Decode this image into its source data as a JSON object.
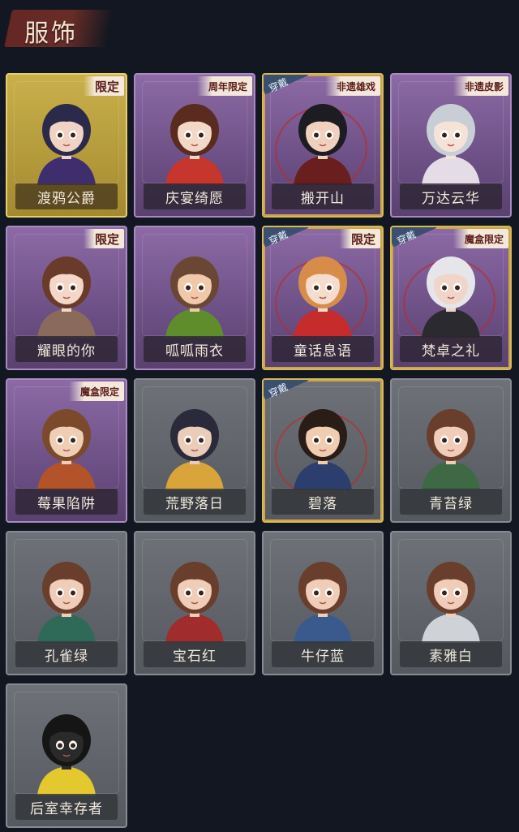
{
  "header": {
    "title": "服饰"
  },
  "cards": [
    {
      "name": "渡鸦公爵",
      "tag": "限定",
      "worn": false,
      "frame": "gold",
      "palette": {
        "hair": "#2b2a4a",
        "skin": "#f0d3c3",
        "outfit": "#3f2e6e"
      }
    },
    {
      "name": "庆宴绮愿",
      "tag": "周年限定",
      "worn": false,
      "frame": "purple",
      "palette": {
        "hair": "#5a2b1f",
        "skin": "#f3d8c6",
        "outfit": "#c7362c"
      }
    },
    {
      "name": "搬开山",
      "tag": "非遗雄戏",
      "worn": true,
      "frame": "purple",
      "palette": {
        "hair": "#1c1c22",
        "skin": "#f0d1bd",
        "outfit": "#6b1e1e"
      }
    },
    {
      "name": "万达云华",
      "tag": "非遗皮影",
      "worn": false,
      "frame": "purple",
      "palette": {
        "hair": "#c9ced6",
        "skin": "#f6e3d8",
        "outfit": "#e4dce6"
      }
    },
    {
      "name": "耀眼的你",
      "tag": "限定",
      "worn": false,
      "frame": "purple",
      "palette": {
        "hair": "#6a3b2a",
        "skin": "#f4d7c8",
        "outfit": "#8a6a5a"
      }
    },
    {
      "name": "呱呱雨衣",
      "tag": "",
      "worn": false,
      "frame": "purple",
      "palette": {
        "hair": "#6a4634",
        "skin": "#f0c9aa",
        "outfit": "#5f8d2c"
      }
    },
    {
      "name": "童话息语",
      "tag": "限定",
      "worn": true,
      "frame": "purple",
      "palette": {
        "hair": "#d88c4a",
        "skin": "#f6dccc",
        "outfit": "#c62c2c"
      }
    },
    {
      "name": "梵卓之礼",
      "tag": "魔盒限定",
      "worn": true,
      "frame": "purple",
      "palette": {
        "hair": "#e6e6ea",
        "skin": "#f0d6c8",
        "outfit": "#2a2a2f"
      }
    },
    {
      "name": "莓果陷阱",
      "tag": "魔盒限定",
      "worn": false,
      "frame": "purple",
      "palette": {
        "hair": "#7a4a2a",
        "skin": "#f0ceb6",
        "outfit": "#b2532a"
      }
    },
    {
      "name": "荒野落日",
      "tag": "",
      "worn": false,
      "frame": "gray",
      "palette": {
        "hair": "#2b2a3a",
        "skin": "#e9cdb8",
        "outfit": "#d9a53a"
      }
    },
    {
      "name": "碧落",
      "tag": "",
      "worn": true,
      "frame": "gray",
      "palette": {
        "hair": "#2a1c16",
        "skin": "#f0ccb1",
        "outfit": "#2c3e6e"
      }
    },
    {
      "name": "青苔绿",
      "tag": "",
      "worn": false,
      "frame": "gray",
      "palette": {
        "hair": "#6a3e2c",
        "skin": "#f0cdb8",
        "outfit": "#3d6a45"
      }
    },
    {
      "name": "孔雀绿",
      "tag": "",
      "worn": false,
      "frame": "gray",
      "palette": {
        "hair": "#6a3e2c",
        "skin": "#f0cdb8",
        "outfit": "#2f6a58"
      }
    },
    {
      "name": "宝石红",
      "tag": "",
      "worn": false,
      "frame": "gray",
      "palette": {
        "hair": "#6a3e2c",
        "skin": "#f0cdb8",
        "outfit": "#a02c2c"
      }
    },
    {
      "name": "牛仔蓝",
      "tag": "",
      "worn": false,
      "frame": "gray",
      "palette": {
        "hair": "#6a3e2c",
        "skin": "#f0cdb8",
        "outfit": "#3a5a8e"
      }
    },
    {
      "name": "素雅白",
      "tag": "",
      "worn": false,
      "frame": "gray",
      "palette": {
        "hair": "#6a3e2c",
        "skin": "#f0cdb8",
        "outfit": "#cfd2d6"
      }
    },
    {
      "name": "后室幸存者",
      "tag": "",
      "worn": false,
      "frame": "gray",
      "palette": {
        "hair": "#151515",
        "skin": "#2a2a2a",
        "outfit": "#e4c92e"
      }
    }
  ],
  "labels": {
    "worn": "穿戴"
  }
}
